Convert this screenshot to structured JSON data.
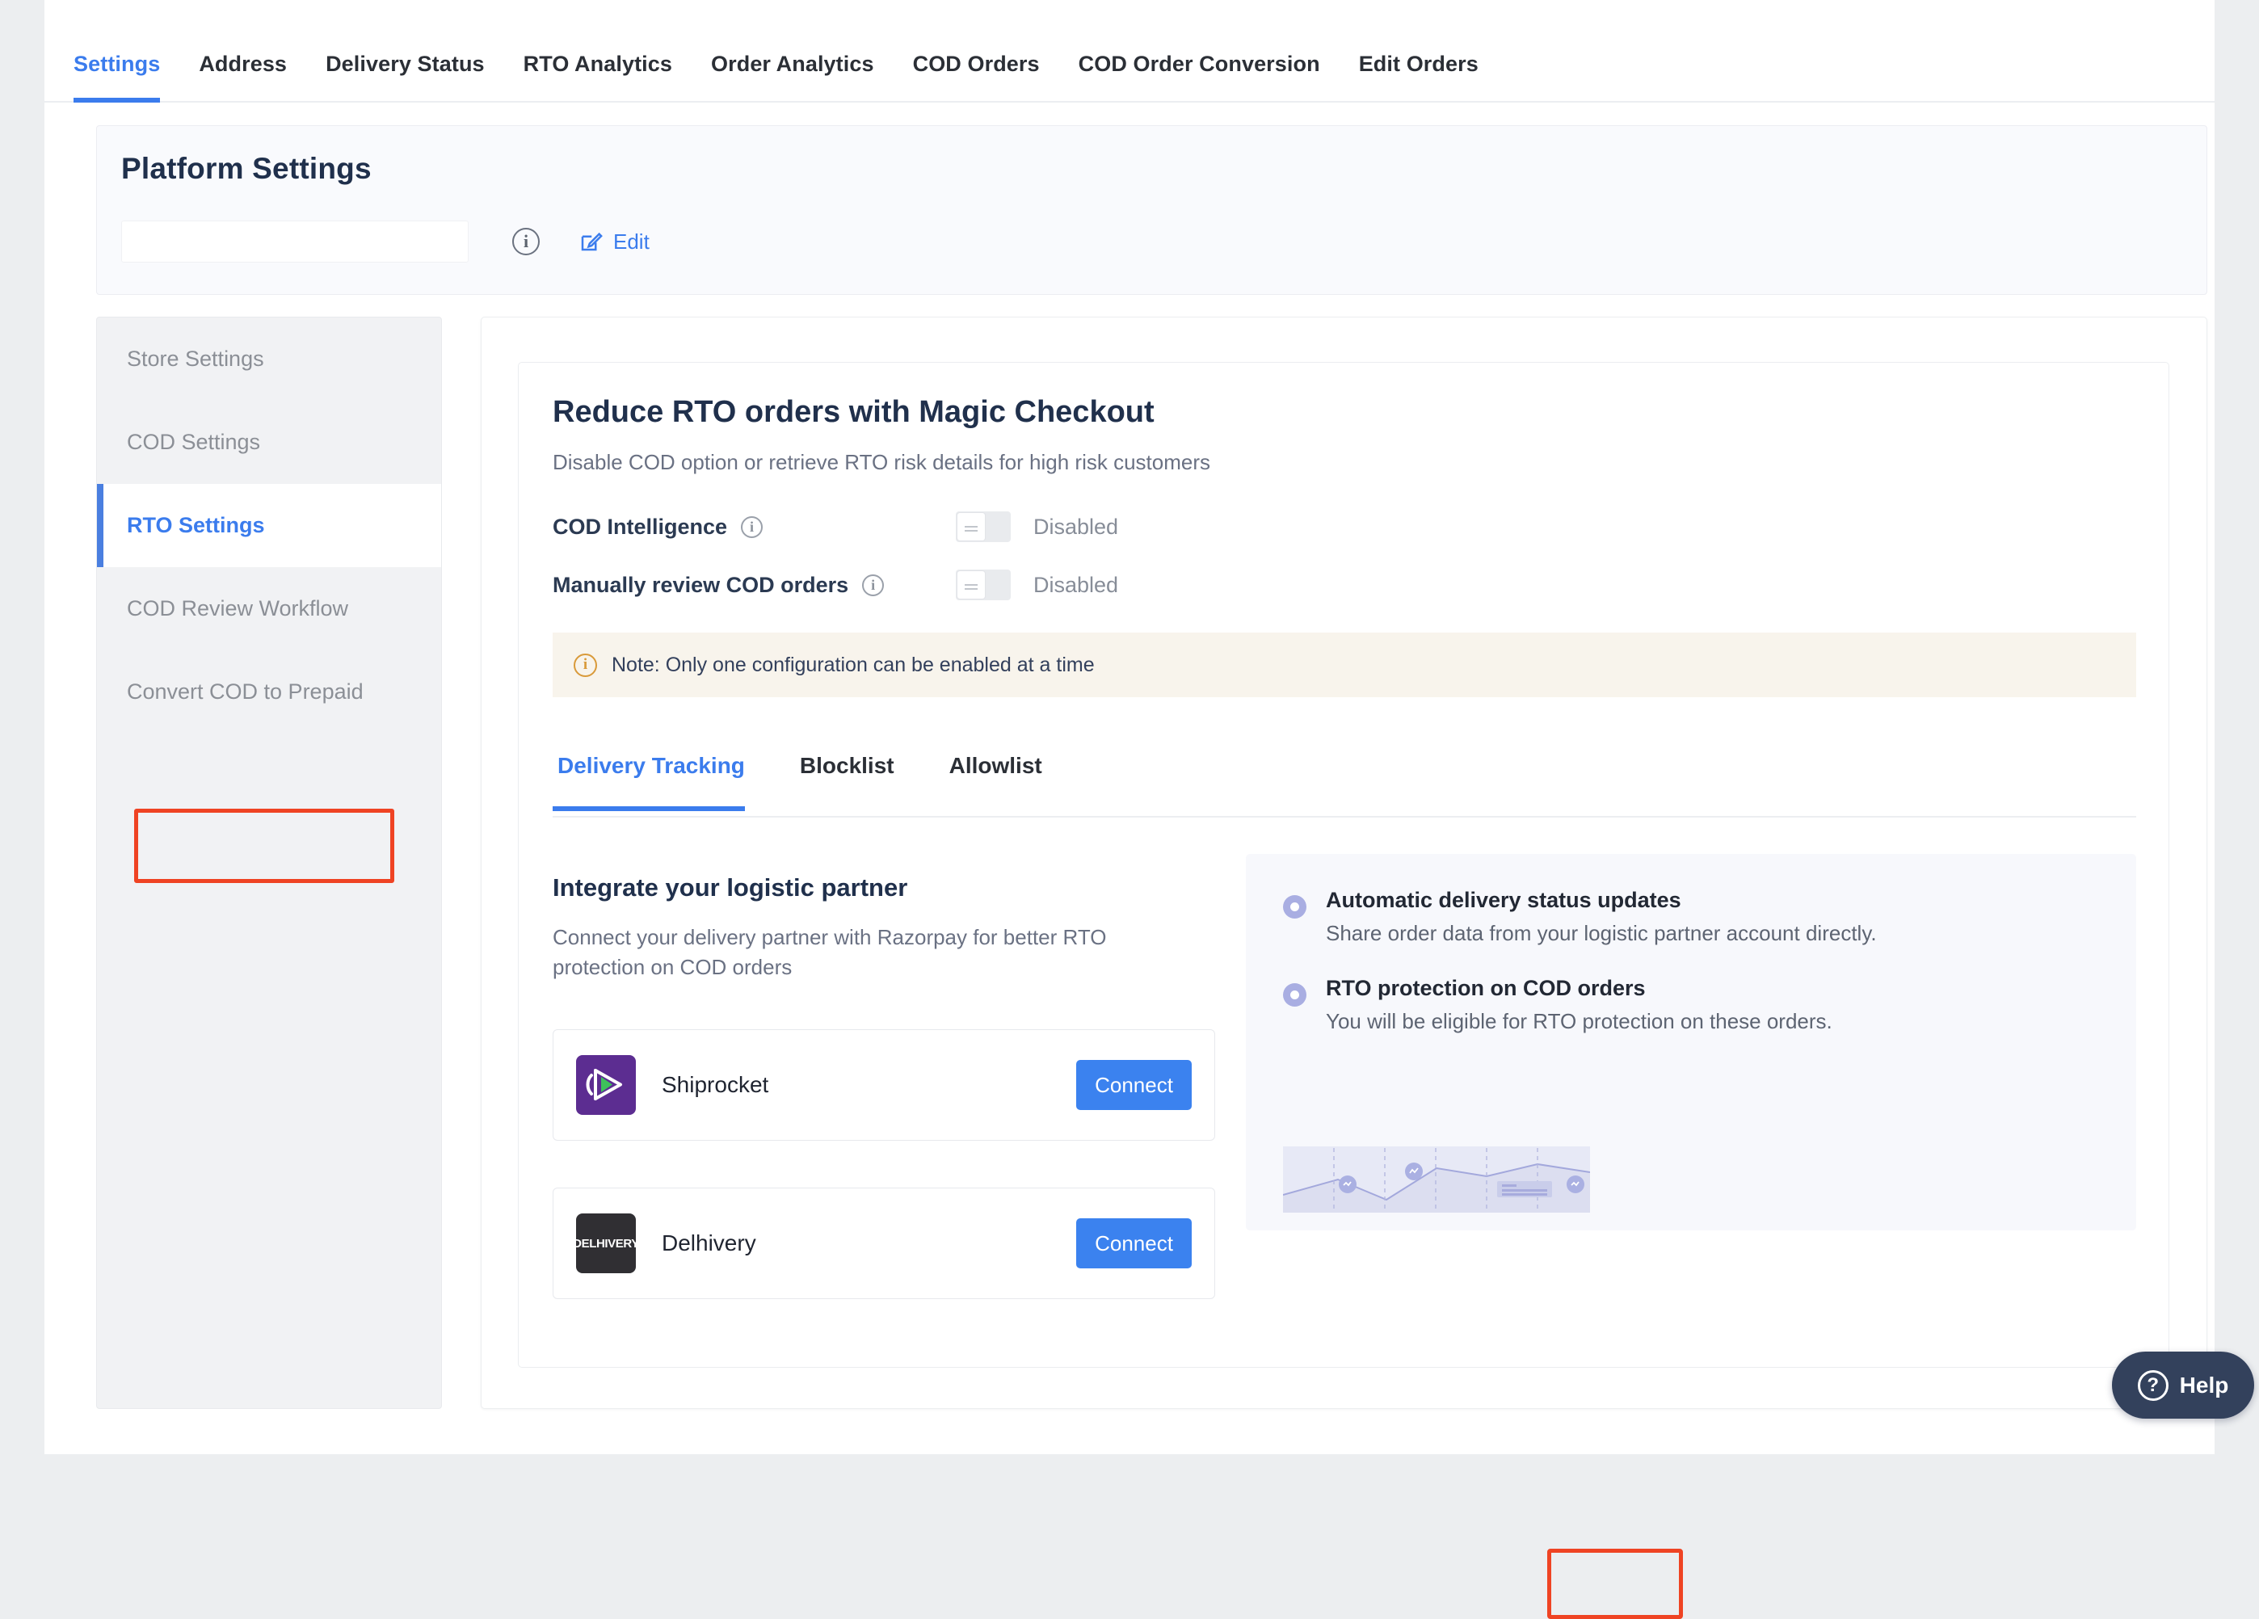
{
  "topnav": {
    "items": [
      {
        "label": "Settings",
        "active": true
      },
      {
        "label": "Address",
        "active": false
      },
      {
        "label": "Delivery Status",
        "active": false
      },
      {
        "label": "RTO Analytics",
        "active": false
      },
      {
        "label": "Order Analytics",
        "active": false
      },
      {
        "label": "COD Orders",
        "active": false
      },
      {
        "label": "COD Order Conversion",
        "active": false
      },
      {
        "label": "Edit Orders",
        "active": false
      }
    ]
  },
  "platform_settings": {
    "title": "Platform Settings",
    "select_value": "",
    "info_icon": "info-icon",
    "edit_icon": "edit-pencil-icon",
    "edit_label": "Edit"
  },
  "sidebar": {
    "items": [
      {
        "label": "Store Settings",
        "active": false
      },
      {
        "label": "COD Settings",
        "active": false
      },
      {
        "label": "RTO Settings",
        "active": true
      },
      {
        "label": "COD Review Workflow",
        "active": false
      },
      {
        "label": "Convert COD to Prepaid",
        "active": false
      }
    ]
  },
  "main": {
    "title": "Reduce RTO orders with Magic Checkout",
    "subtitle": "Disable COD option or retrieve RTO risk details for high risk customers",
    "toggles": [
      {
        "label": "COD Intelligence",
        "state": "Disabled",
        "on": false
      },
      {
        "label": "Manually review COD orders",
        "state": "Disabled",
        "on": false
      }
    ],
    "note": {
      "icon": "info-icon",
      "text": "Note: Only one configuration can be enabled at a time"
    },
    "tabs": [
      {
        "label": "Delivery Tracking",
        "active": true
      },
      {
        "label": "Blocklist",
        "active": false
      },
      {
        "label": "Allowlist",
        "active": false
      }
    ],
    "integrate": {
      "title": "Integrate your logistic partner",
      "description": "Connect your delivery partner with Razorpay for better RTO protection on COD orders"
    },
    "partners": [
      {
        "name": "Shiprocket",
        "logo": "shiprocket-logo",
        "button": "Connect",
        "highlighted": false
      },
      {
        "name": "Delhivery",
        "logo": "delhivery-logo",
        "logo_text": "DELHIVERY",
        "button": "Connect",
        "highlighted": true
      }
    ],
    "info_panel": {
      "bullets": [
        {
          "title": "Automatic delivery status updates",
          "description": "Share order data from your logistic partner account directly."
        },
        {
          "title": "RTO protection on COD orders",
          "description": "You will be eligible for RTO protection on these orders."
        }
      ],
      "illustration": "area-chart-illustration"
    }
  },
  "help": {
    "icon": "question-mark-circle-icon",
    "label": "Help"
  },
  "colors": {
    "accent_blue": "#3b7ced",
    "button_blue": "#3b82ef",
    "highlight_red": "#ef4323",
    "heading_navy": "#20304c",
    "note_bg": "#f8f4ec",
    "shiprocket_purple": "#5c2d91",
    "delhivery_dark": "#302f33",
    "help_navy": "#33415c"
  }
}
